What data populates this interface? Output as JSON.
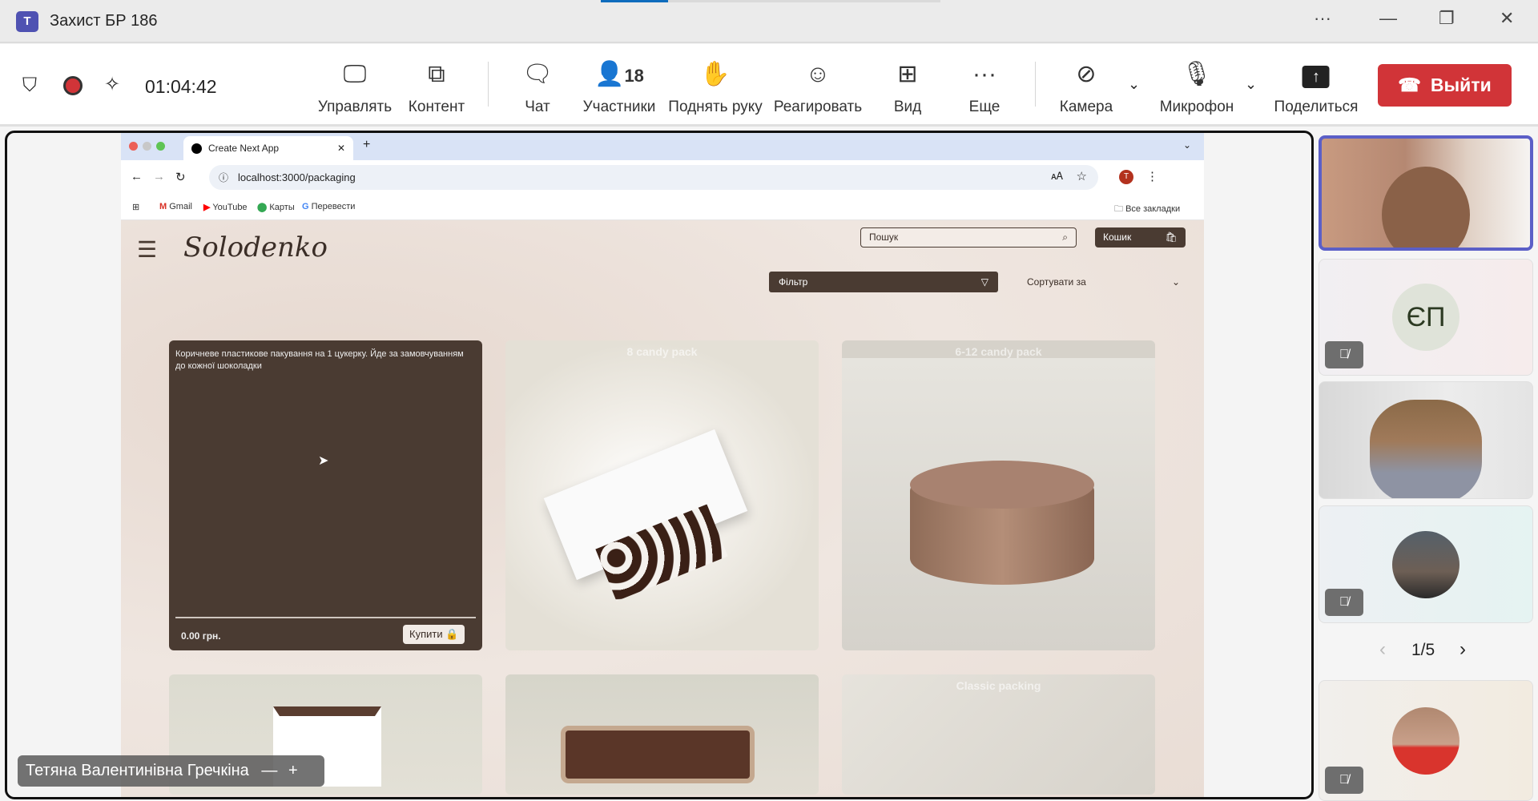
{
  "window": {
    "title": "Захист БР 186",
    "app_icon": "teams-logo",
    "controls": [
      "more",
      "minimize",
      "restore",
      "close"
    ]
  },
  "toolbar": {
    "timer": "01:04:42",
    "manage": "Управлять",
    "content": "Контент",
    "chat": "Чат",
    "participants": "Участники",
    "participants_count": "18",
    "raise_hand": "Поднять руку",
    "react": "Реагировать",
    "view": "Вид",
    "more": "Еще",
    "camera": "Камера",
    "mic": "Микрофон",
    "share": "Поделиться",
    "leave": "Выйти",
    "leave_color": "#d13438"
  },
  "browser": {
    "tab_title": "Create Next App",
    "url": "localhost:3000/packaging",
    "profile_initial": "T",
    "bookmarks": [
      "Gmail",
      "YouTube",
      "Карты",
      "Перевести"
    ],
    "all_bookmarks": "Все закладки"
  },
  "site": {
    "search_placeholder": "Пошук",
    "cart": "Кошик",
    "filter": "Фільтр",
    "sort": "Сортувати за",
    "cards": [
      {
        "description": "Коричневе пластикове пакування на 1 цукерку. Йде за замовчуванням до кожної шоколадки",
        "price": "0.00 грн.",
        "buy": "Купити"
      },
      {
        "title": "8 candy pack"
      },
      {
        "title": "6-12 candy pack"
      },
      {
        "title": ""
      },
      {
        "title": ""
      },
      {
        "title": "Classic packing"
      }
    ]
  },
  "participants": {
    "initials": "ЄП",
    "page": "1/5"
  },
  "presenter": {
    "name": "Тетяна Валентинівна Гречкіна"
  }
}
